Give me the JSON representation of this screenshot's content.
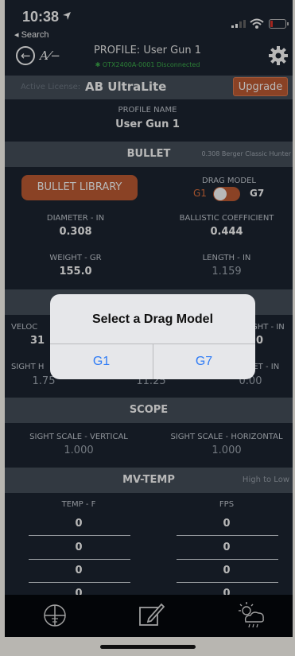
{
  "status": {
    "time": "10:38",
    "back_label": "◂ Search"
  },
  "header": {
    "title": "PROFILE: User Gun 1",
    "device_status": "OTX2400A-0001 Disconnected",
    "logo_text": "A"
  },
  "license": {
    "label": "Active License:",
    "name": "AB UltraLite",
    "upgrade_label": "Upgrade"
  },
  "profile": {
    "label": "PROFILE NAME",
    "value": "User Gun 1"
  },
  "bullet": {
    "section_title": "BULLET",
    "bullet_name": "0.308 Berger Classic Hunter",
    "library_button": "BULLET LIBRARY",
    "drag_model_label": "DRAG MODEL",
    "drag_g1": "G1",
    "drag_g7": "G7",
    "drag_selected": "G7",
    "diameter_label": "DIAMETER - IN",
    "diameter_value": "0.308",
    "bc_label": "BALLISTIC COEFFICIENT",
    "bc_value": "0.444",
    "weight_label": "WEIGHT - GR",
    "weight_value": "155.0",
    "length_label": "LENGTH - IN",
    "length_value": "1.159"
  },
  "gun_partial": {
    "velocity_label_partial": "VELOC",
    "velocity_value_partial": "31",
    "right_label_partial": "GHT - IN",
    "right_value_partial": "0",
    "sight_height_label_partial": "SIGHT H",
    "sight_height_value": "1.75",
    "twist_value": "11.25",
    "offset_label_partial": "SET - IN",
    "offset_value": "0.00"
  },
  "scope": {
    "section_title": "SCOPE",
    "vertical_label": "SIGHT SCALE - VERTICAL",
    "vertical_value": "1.000",
    "horizontal_label": "SIGHT SCALE - HORIZONTAL",
    "horizontal_value": "1.000"
  },
  "mvtemp": {
    "section_title": "MV-TEMP",
    "order_label": "High to Low",
    "temp_header": "TEMP - F",
    "fps_header": "FPS",
    "rows": [
      {
        "temp": "0",
        "fps": "0"
      },
      {
        "temp": "0",
        "fps": "0"
      },
      {
        "temp": "0",
        "fps": "0"
      },
      {
        "temp": "0",
        "fps": "0"
      }
    ]
  },
  "alert": {
    "title": "Select a Drag Model",
    "option_g1": "G1",
    "option_g7": "G7"
  },
  "tabs": [
    {
      "icon": "crosshair-icon"
    },
    {
      "icon": "edit-icon"
    },
    {
      "icon": "weather-icon"
    }
  ],
  "colors": {
    "accent": "#c05c34",
    "background": "#1c2531",
    "section": "#46505b",
    "connected_green": "#3db24c",
    "alert_button": "#2f7cf6"
  }
}
